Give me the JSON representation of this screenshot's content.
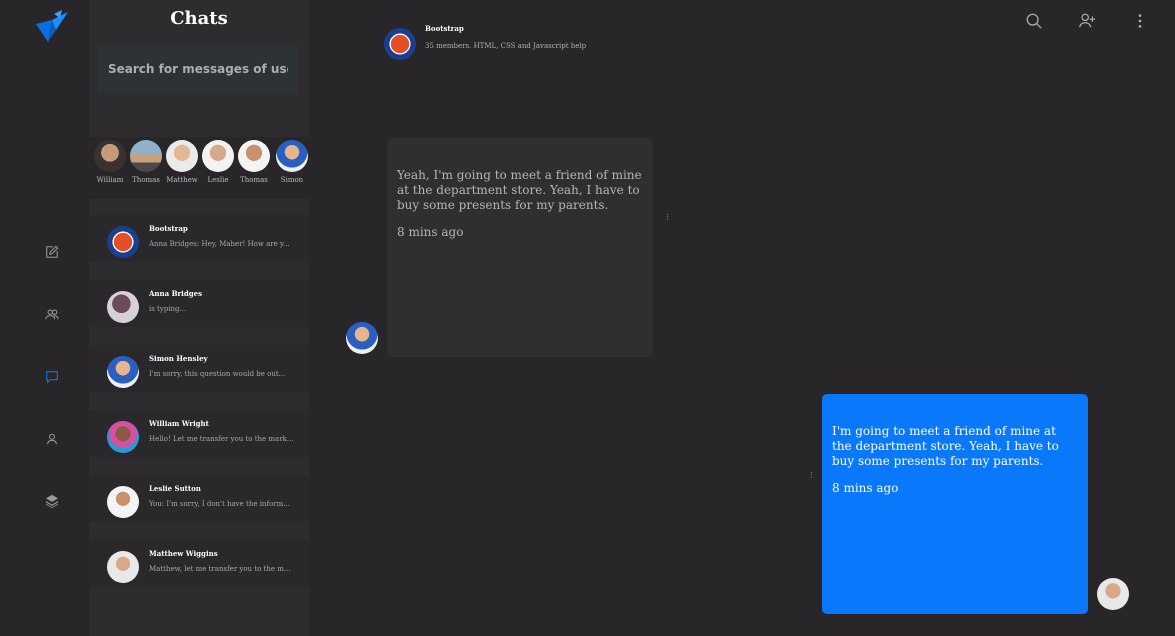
{
  "colors": {
    "accent": "#0a78fb",
    "background": "#282629",
    "panel": "#2f2c30"
  },
  "rail": {
    "items": [
      {
        "icon": "edit-icon"
      },
      {
        "icon": "users-icon"
      },
      {
        "icon": "chat-icon",
        "active": true
      },
      {
        "icon": "user-icon"
      },
      {
        "icon": "layers-icon"
      }
    ]
  },
  "chats": {
    "title": "Chats",
    "search_placeholder": "Search for messages of users",
    "stories": [
      {
        "name": "William"
      },
      {
        "name": "Thomas"
      },
      {
        "name": "Matthew"
      },
      {
        "name": "Leslie"
      },
      {
        "name": "Thomas"
      },
      {
        "name": "Simon"
      }
    ],
    "conversations": [
      {
        "name": "Bootstrap",
        "preview": "Anna Bridges: Hey, Maher! How are y..."
      },
      {
        "name": "Anna Bridges",
        "preview": "is typing..."
      },
      {
        "name": "Simon Hensley",
        "preview": "I'm sorry, this question would be out..."
      },
      {
        "name": "William Wright",
        "preview": "Hello! Let me transfer you to the mark..."
      },
      {
        "name": "Leslie Sutton",
        "preview": "You: I'm sorry, I don't have the inform..."
      },
      {
        "name": "Matthew Wiggins",
        "preview": "Matthew, let me transfer you to the m..."
      }
    ]
  },
  "header": {
    "name": "Bootstrap",
    "subtitle": "35 members. HTML, CSS and Javascript help",
    "actions": [
      "search-icon",
      "add-user-icon",
      "more-icon"
    ]
  },
  "messages": [
    {
      "direction": "in",
      "text": "Yeah, I'm going to meet a friend of mine at the department store. Yeah, I have to buy some presents for my parents.",
      "time": "8 mins ago"
    },
    {
      "direction": "out",
      "text": "I'm going to meet a friend of mine at the department store. Yeah, I have to buy some presents for my parents.",
      "time": "8 mins ago"
    }
  ]
}
